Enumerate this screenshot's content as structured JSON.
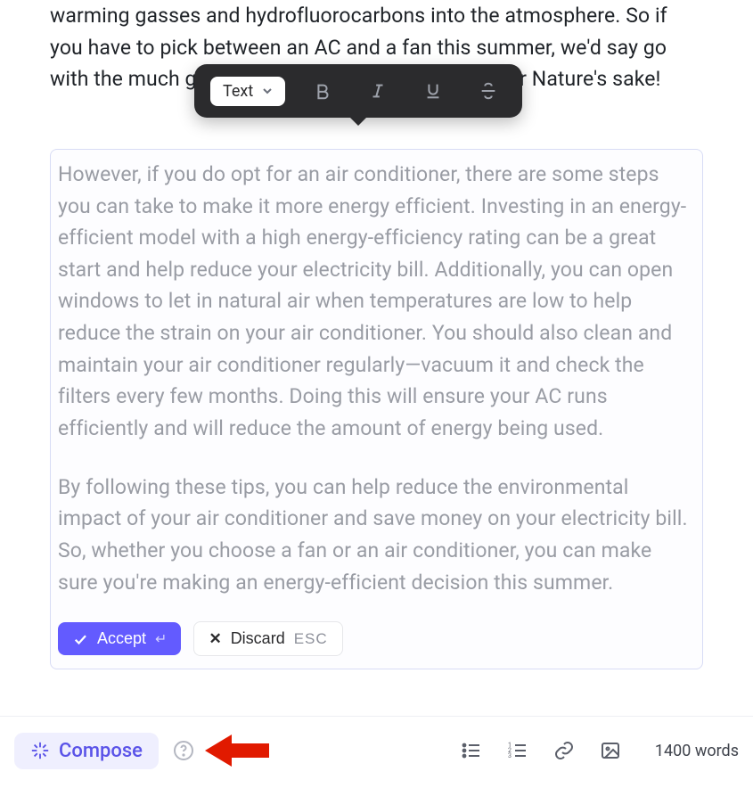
{
  "document": {
    "visible_text_top": "warming gasses and hydrofluorocarbons into the atmosphere. So if you have to pick between an AC and a fan this summer, we'd say go with the much greener option—for yours and Mother Nature's sake!",
    "suggestion": {
      "para1": "However, if you do opt for an air conditioner, there are some steps you can take to make it more energy efficient. Investing in an energy-efficient model with a high energy-efficiency rating can be a great start and help reduce your electricity bill. Additionally, you can open windows to let in natural air when temperatures are low to help reduce the strain on your air conditioner. You should also clean and maintain your air conditioner regularly—vacuum it and check the filters every few months. Doing this will ensure your AC runs efficiently and will reduce the amount of energy being used.",
      "para2": "By following these tips, you can help reduce the environmental impact of your air conditioner and save money on your electricity bill. So, whether you choose a fan or an air conditioner, you can make sure you're making an energy-efficient decision this summer."
    }
  },
  "floating_toolbar": {
    "text_dropdown_label": "Text",
    "icons": {
      "bold": "bold-icon",
      "italic": "italic-icon",
      "underline": "underline-icon",
      "strike": "strikethrough-icon"
    }
  },
  "actions": {
    "accept_label": "Accept",
    "accept_shortcut_glyph": "↵",
    "discard_label": "Discard",
    "discard_shortcut": "ESC"
  },
  "bottom": {
    "compose_label": "Compose",
    "word_count_label": "1400 words",
    "icons": {
      "bullet_list": "bullet-list-icon",
      "numbered_list": "numbered-list-icon",
      "link": "link-icon",
      "image": "image-icon",
      "help": "help-icon",
      "compose_sparkle": "sparkle-icon"
    }
  },
  "annotation": {
    "red_arrow": "points at help icon next to Compose"
  },
  "colors": {
    "accent": "#635bff",
    "accent_light": "#efeffe",
    "text_muted": "#999ca4"
  }
}
